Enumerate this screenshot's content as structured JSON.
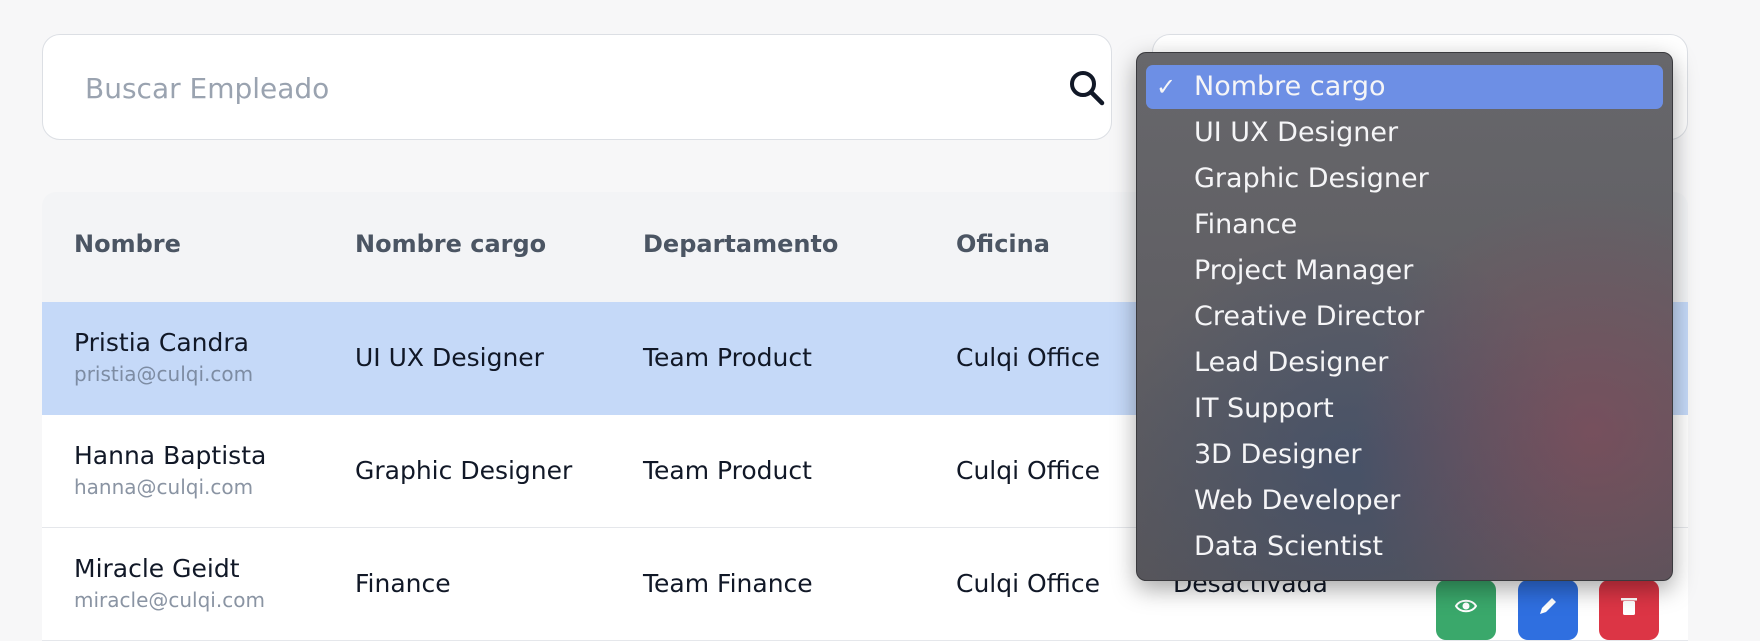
{
  "search": {
    "placeholder": "Buscar Empleado",
    "value": ""
  },
  "table": {
    "headers": [
      "Nombre",
      "Nombre cargo",
      "Departamento",
      "Oficina"
    ],
    "rows": [
      {
        "name": "Pristia Candra",
        "email": "pristia@culqi.com",
        "position": "UI UX Designer",
        "department": "Team Product",
        "office": "Culqi Office",
        "status": ""
      },
      {
        "name": "Hanna Baptista",
        "email": "hanna@culqi.com",
        "position": "Graphic Designer",
        "department": "Team Product",
        "office": "Culqi Office",
        "status": ""
      },
      {
        "name": "Miracle Geidt",
        "email": "miracle@culqi.com",
        "position": "Finance",
        "department": "Team Finance",
        "office": "Culqi Office",
        "status": "Desactivada"
      }
    ]
  },
  "dropdown": {
    "selected": "Nombre cargo",
    "check": "✓",
    "options": [
      "Nombre cargo",
      "UI UX Designer",
      "Graphic Designer",
      "Finance",
      "Project Manager",
      "Creative Director",
      "Lead Designer",
      "IT Support",
      "3D Designer",
      "Web Developer",
      "Data Scientist"
    ]
  },
  "icons": {
    "search": "search-icon",
    "chevron": "chevron-down-icon",
    "view": "eye-icon",
    "edit": "pencil-icon",
    "delete": "trash-icon"
  },
  "colors": {
    "selected_row": "#c5d9f8",
    "dropdown_highlight": "#6d8fe5",
    "view_button": "#3aa86b",
    "edit_button": "#2f6fe0",
    "delete_button": "#dc3545"
  }
}
